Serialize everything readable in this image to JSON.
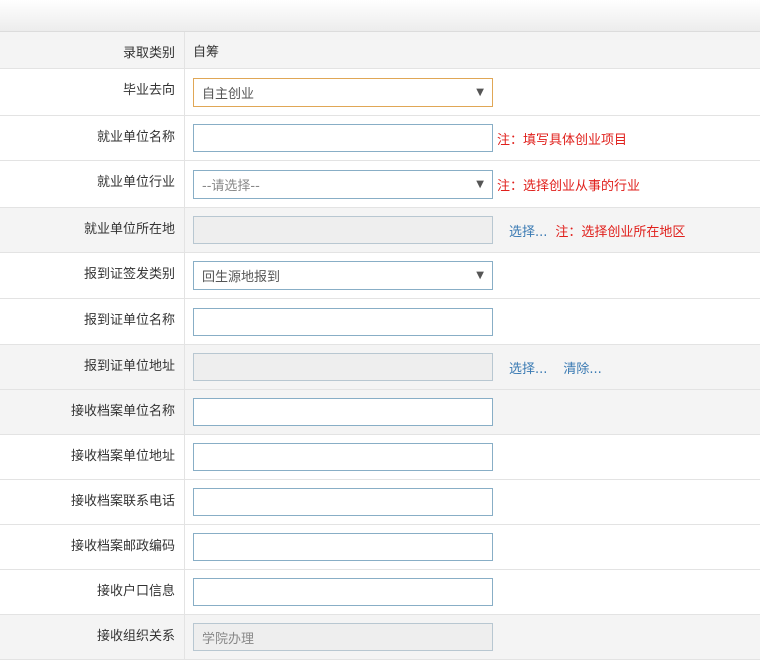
{
  "form": {
    "rows": [
      {
        "label": "录取类别",
        "value": "自筹"
      },
      {
        "label": "毕业去向",
        "value": "自主创业"
      },
      {
        "label": "就业单位名称",
        "value": "",
        "note": "注：填写具体创业项目"
      },
      {
        "label": "就业单位行业",
        "placeholder": "--请选择--",
        "note": "注：选择创业从事的行业"
      },
      {
        "label": "就业单位所在地",
        "value": "",
        "link": "选择...",
        "note": "注：选择创业所在地区"
      },
      {
        "label": "报到证签发类别",
        "value": "回生源地报到"
      },
      {
        "label": "报到证单位名称",
        "value": ""
      },
      {
        "label": "报到证单位地址",
        "value": "",
        "link_select": "选择...",
        "link_clear": "清除..."
      },
      {
        "label": "接收档案单位名称",
        "value": ""
      },
      {
        "label": "接收档案单位地址",
        "value": ""
      },
      {
        "label": "接收档案联系电话",
        "value": ""
      },
      {
        "label": "接收档案邮政编码",
        "value": ""
      },
      {
        "label": "接收户口信息",
        "value": ""
      },
      {
        "label": "接收组织关系",
        "value": "学院办理"
      }
    ]
  },
  "colors": {
    "note": "#e0201c",
    "link": "#3a7ab3",
    "input_border": "#88aec6",
    "focus_border": "#e0a756"
  }
}
